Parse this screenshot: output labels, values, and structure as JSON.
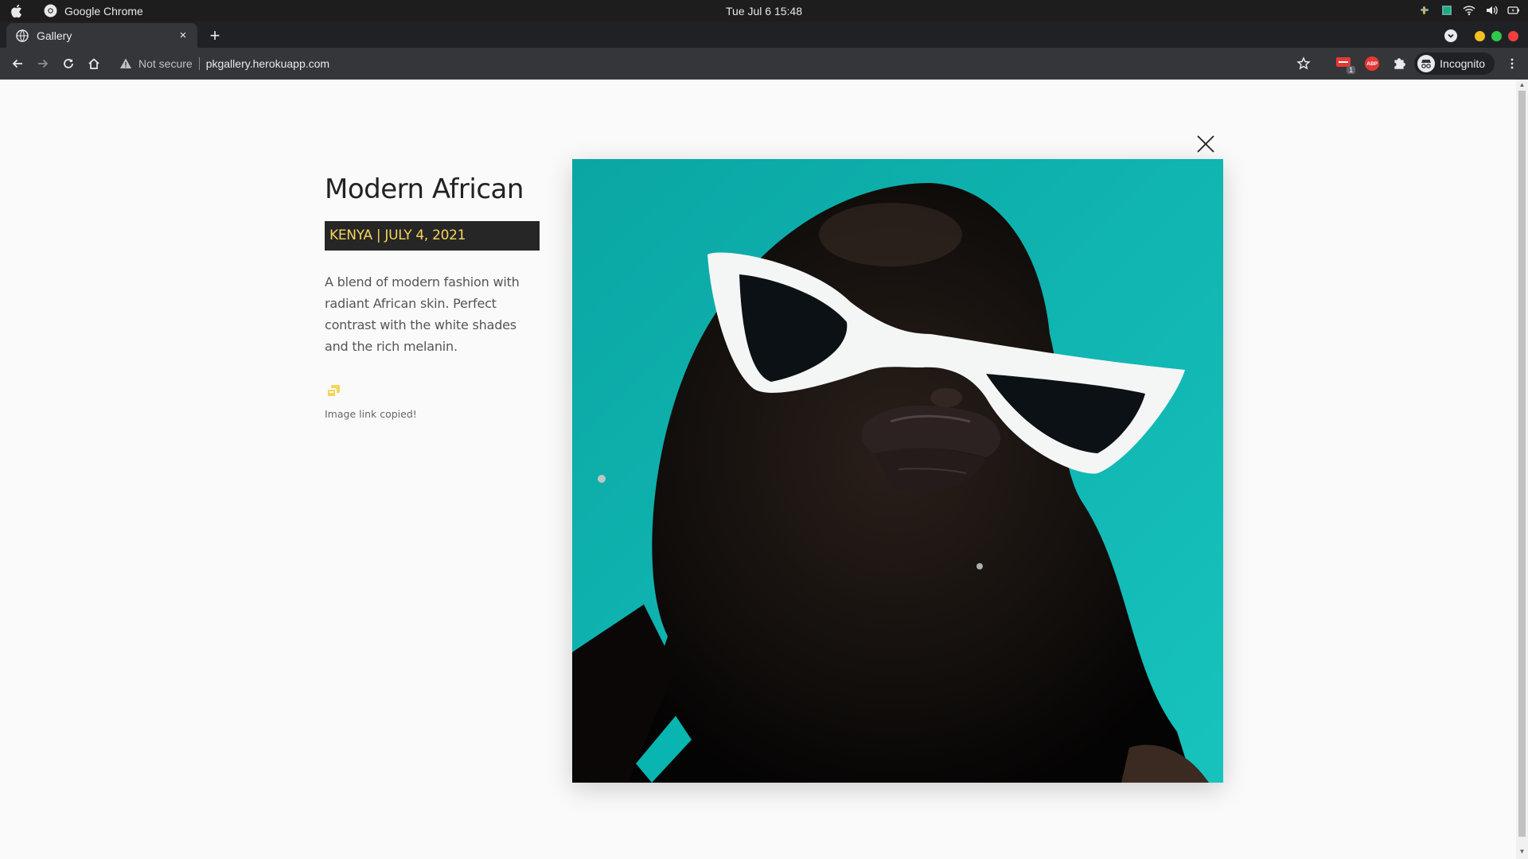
{
  "os": {
    "app_name": "Google Chrome",
    "clock": "Tue Jul 6  15:48"
  },
  "browser": {
    "tab_title": "Gallery",
    "new_tab": "+",
    "tab_close": "×",
    "security_label": "Not secure",
    "url": "pkgallery.herokuapp.com",
    "profile_label": "Incognito",
    "ext_badge": "1",
    "abp_label": "ABP"
  },
  "gallery": {
    "title": "Modern African",
    "tag": "KENYA | JULY 4, 2021",
    "description": "A blend of modern fashion with radiant African skin. Perfect contrast with the white shades and the rich melanin.",
    "copy_status": "Image link copied!",
    "accent_color": "#f5d55a",
    "photo_bg": "#12b3b0"
  }
}
